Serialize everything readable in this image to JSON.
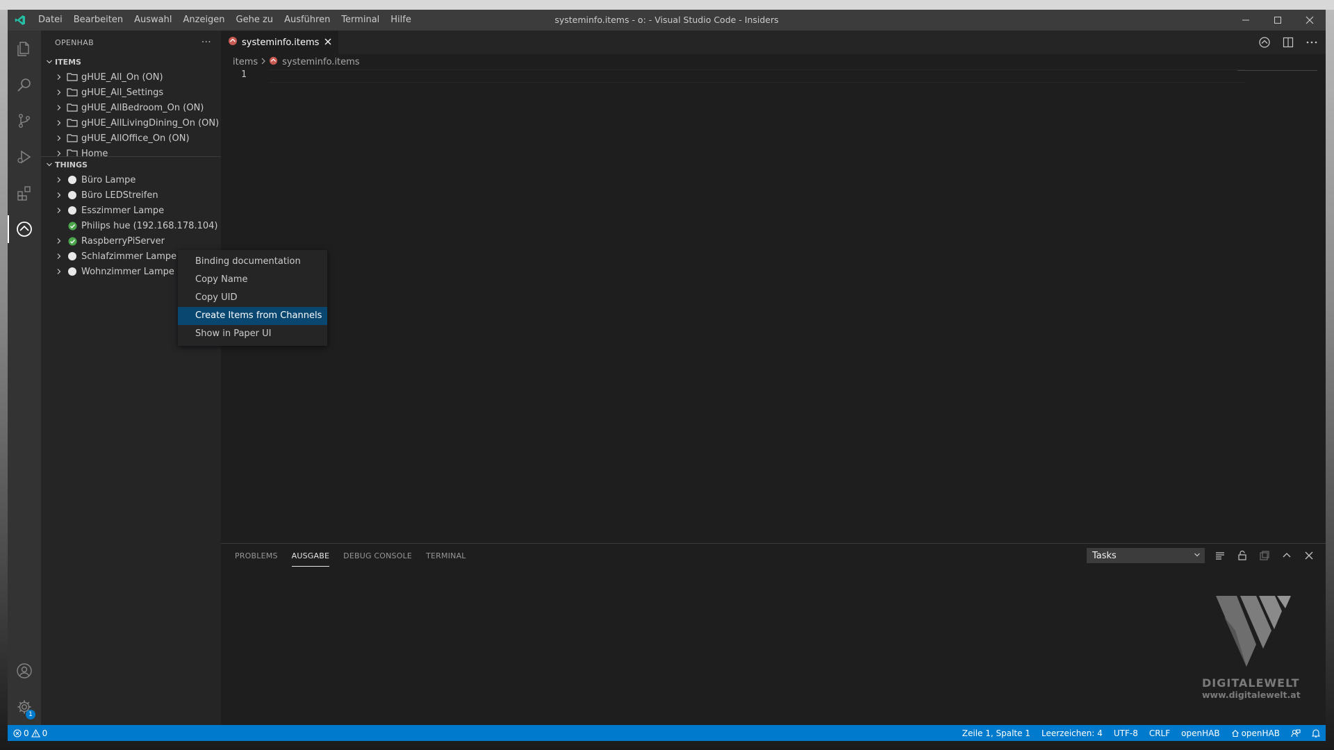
{
  "titlebar": {
    "menu": [
      "Datei",
      "Bearbeiten",
      "Auswahl",
      "Anzeigen",
      "Gehe zu",
      "Ausführen",
      "Terminal",
      "Hilfe"
    ],
    "window_title": "systeminfo.items - o: - Visual Studio Code - Insiders"
  },
  "sidebar": {
    "title": "OPENHAB",
    "more_label": "···",
    "items_section": {
      "title": "ITEMS",
      "items": [
        {
          "label": "gHUE_All_On (ON)"
        },
        {
          "label": "gHUE_All_Settings"
        },
        {
          "label": "gHUE_AllBedroom_On (ON)"
        },
        {
          "label": "gHUE_AllLivingDining_On (ON)"
        },
        {
          "label": "gHUE_AllOffice_On (ON)"
        },
        {
          "label": "Home"
        }
      ]
    },
    "things_section": {
      "title": "THINGS",
      "items": [
        {
          "label": "Büro Lampe",
          "status": "offline"
        },
        {
          "label": "Büro LEDStreifen",
          "status": "offline"
        },
        {
          "label": "Esszimmer Lampe",
          "status": "offline"
        },
        {
          "label": "Philips hue (192.168.178.104)",
          "status": "online"
        },
        {
          "label": "RaspberryPiServer",
          "status": "online"
        },
        {
          "label": "Schlafzimmer Lampe",
          "status": "offline"
        },
        {
          "label": "Wohnzimmer Lampe",
          "status": "offline"
        }
      ]
    }
  },
  "context_menu": {
    "items": [
      "Binding documentation",
      "Copy Name",
      "Copy UID",
      "Create Items from Channels",
      "Show in Paper UI"
    ],
    "highlighted": "Create Items from Channels"
  },
  "editor": {
    "tab_label": "systeminfo.items",
    "breadcrumb": [
      "items",
      "systeminfo.items"
    ],
    "line_number": "1"
  },
  "panel": {
    "tabs": [
      "PROBLEMS",
      "AUSGABE",
      "DEBUG CONSOLE",
      "TERMINAL"
    ],
    "active_tab": "AUSGABE",
    "output_channel": "Tasks"
  },
  "watermark": {
    "brand": "DIGITALEWELT",
    "url": "www.digitalewelt.at"
  },
  "statusbar": {
    "errors": "0",
    "warnings": "0",
    "position": "Zeile 1, Spalte 1",
    "indent": "Leerzeichen: 4",
    "encoding": "UTF-8",
    "eol": "CRLF",
    "language": "openHAB",
    "server": "openHAB"
  },
  "colors": {
    "accent": "#007acc",
    "menu_highlight": "#094771",
    "online": "#4ca64c",
    "offline": "#e8e8e8"
  },
  "icons": {
    "activity_bar": [
      "explorer-icon",
      "search-icon",
      "source-control-icon",
      "run-debug-icon",
      "extensions-icon",
      "openhab-icon"
    ],
    "activity_bottom": [
      "account-icon",
      "settings-gear-icon"
    ],
    "gear_badge": "1"
  }
}
